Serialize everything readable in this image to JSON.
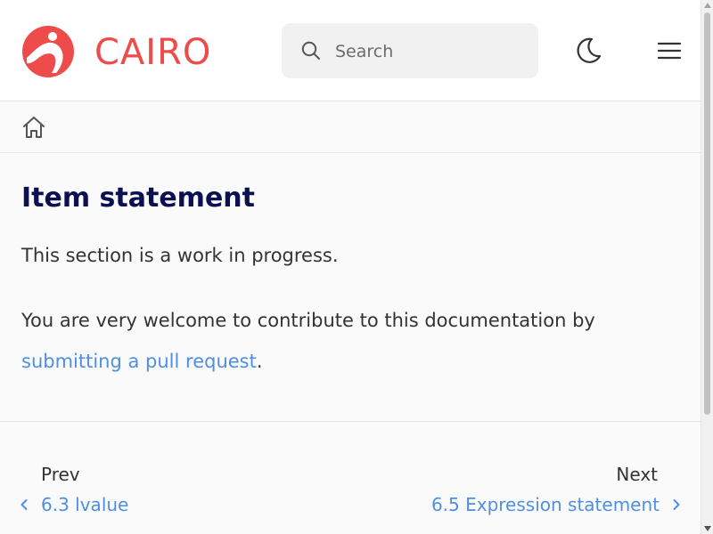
{
  "header": {
    "brand": "CAIRO",
    "search_placeholder": "Search",
    "icons": {
      "logo": "cairo-logo-icon",
      "search": "search-icon",
      "theme": "moon-icon",
      "menu": "hamburger-menu-icon"
    }
  },
  "breadcrumb": {
    "home_icon": "home-icon"
  },
  "content": {
    "title": "Item statement",
    "para1": "This section is a work in progress.",
    "para2_prefix": "You are very welcome to contribute to this documentation by",
    "para2_link": "submitting a pull request",
    "para2_suffix": "."
  },
  "pagination": {
    "prev_label": "Prev",
    "prev_link": "6.3 lvalue",
    "next_label": "Next",
    "next_link": "6.5 Expression statement"
  },
  "colors": {
    "brand": "#ee4b4b",
    "title": "#0b1150",
    "link": "#4f8fe3",
    "text": "#333333"
  }
}
